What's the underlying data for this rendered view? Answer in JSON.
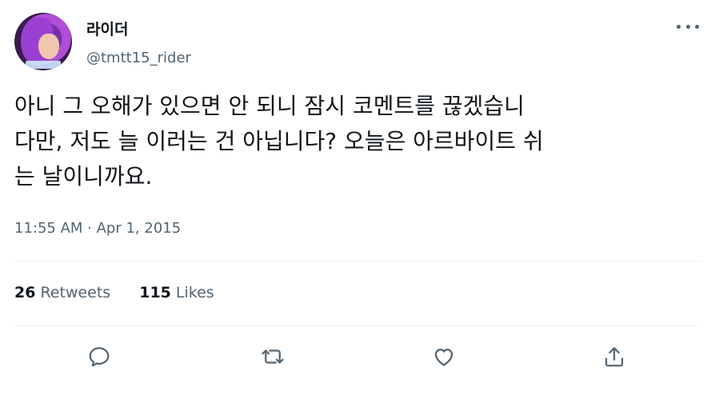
{
  "author": {
    "display_name": "라이더",
    "handle": "@tmtt15_rider",
    "avatar_icon": "avatar-image"
  },
  "tweet": {
    "text": "아니 그 오해가 있으면 안 되니 잠시 코멘트를 끊겠습니\n다만, 저도 늘 이러는 건 아닙니다? 오늘은 아르바이트 쉬\n는 날이니까요.",
    "timestamp": "11:55 AM · Apr 1, 2015"
  },
  "stats": {
    "retweets_count": "26",
    "retweets_label": "Retweets",
    "likes_count": "115",
    "likes_label": "Likes"
  },
  "actions": [
    {
      "name": "reply",
      "icon": "reply-icon"
    },
    {
      "name": "retweet",
      "icon": "retweet-icon"
    },
    {
      "name": "like",
      "icon": "heart-icon"
    },
    {
      "name": "share",
      "icon": "share-icon"
    }
  ],
  "colors": {
    "text_primary": "#0f1419",
    "text_secondary": "#536471",
    "divider": "#eff3f4"
  }
}
